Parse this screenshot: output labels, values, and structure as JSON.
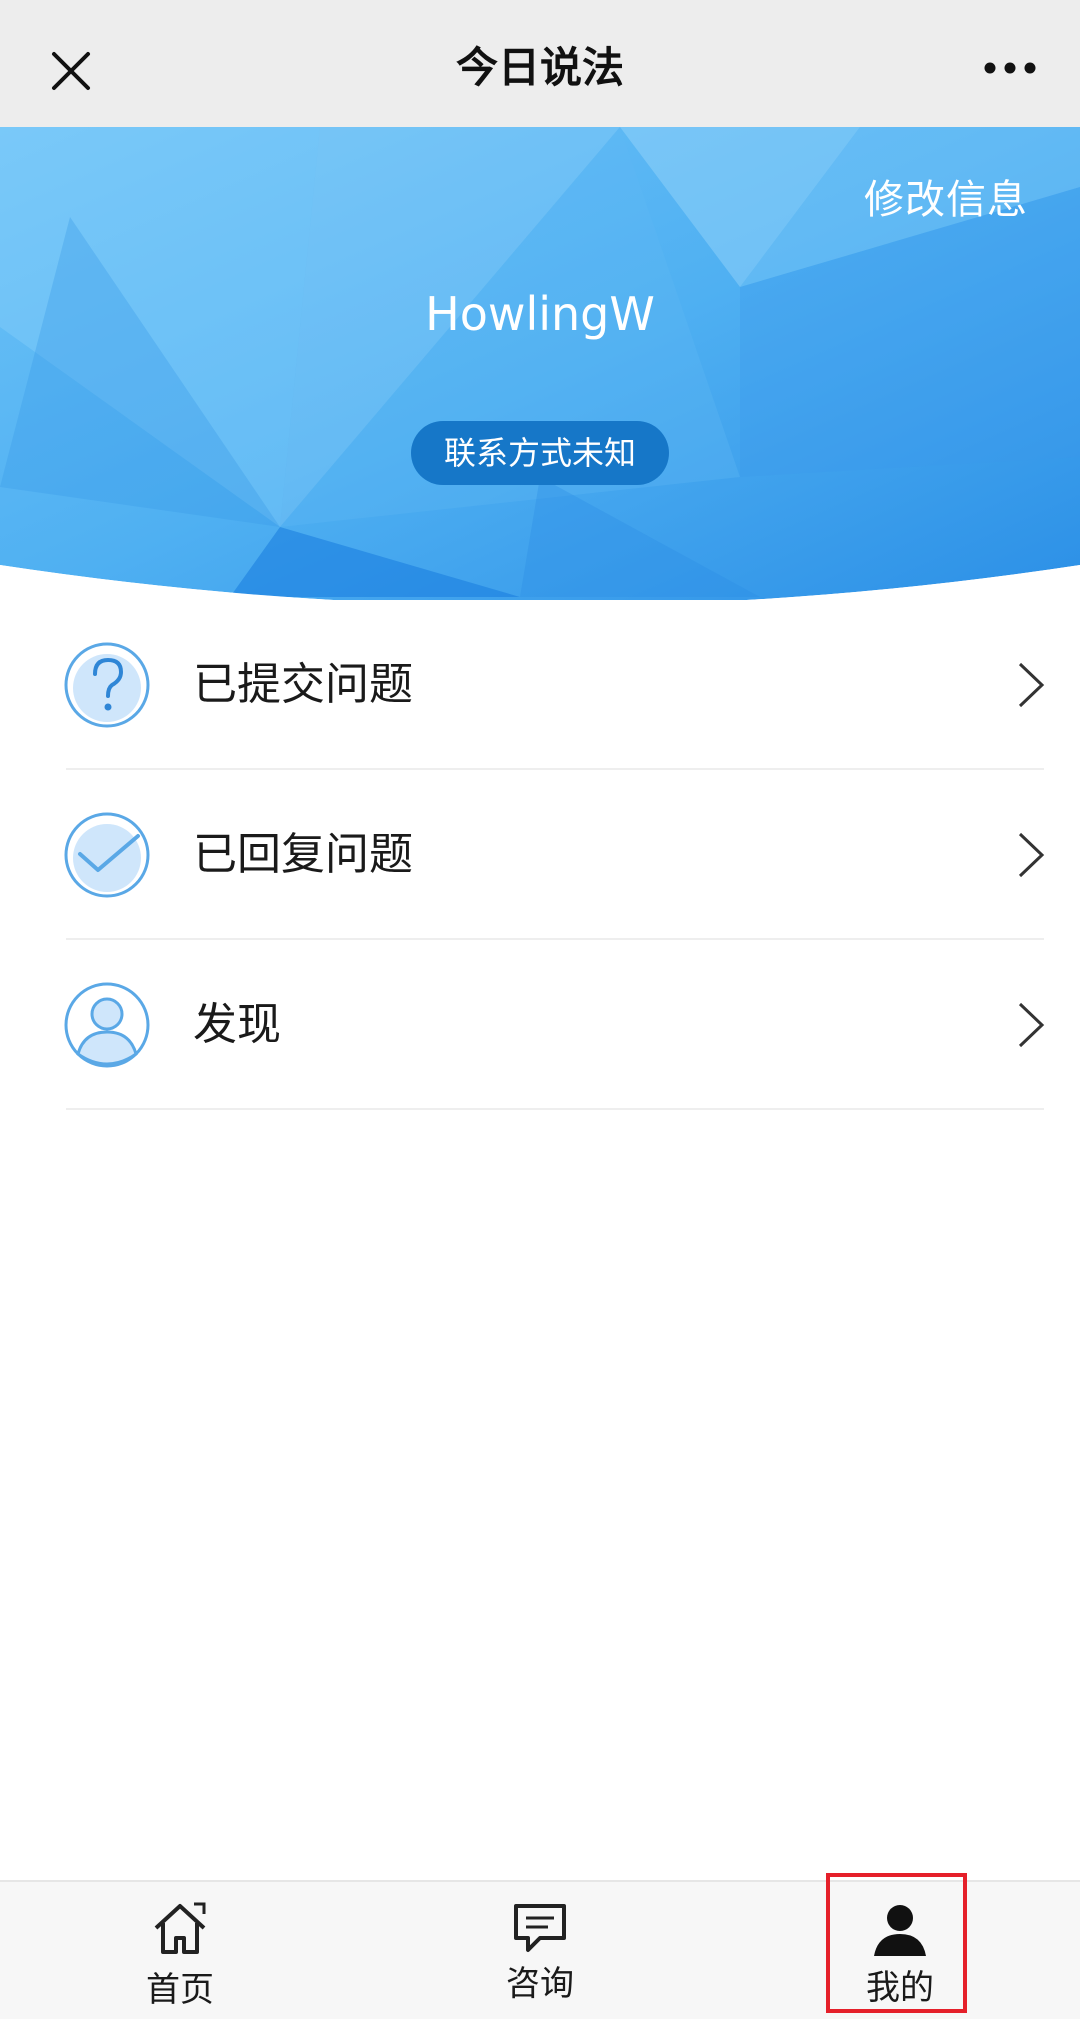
{
  "app": {
    "title": "今日说法",
    "close_icon": "close-icon",
    "more_icon": "more-icon"
  },
  "profile": {
    "edit_label": "修改信息",
    "username": "HowlingW",
    "contact_badge": "联系方式未知"
  },
  "menu": {
    "items": [
      {
        "label": "已提交问题",
        "icon": "question-icon"
      },
      {
        "label": "已回复问题",
        "icon": "check-icon"
      },
      {
        "label": "发现",
        "icon": "user-icon"
      }
    ]
  },
  "tabbar": {
    "tabs": [
      {
        "label": "首页",
        "icon": "home-icon"
      },
      {
        "label": "咨询",
        "icon": "chat-icon"
      },
      {
        "label": "我的",
        "icon": "person-icon",
        "active": true
      }
    ]
  },
  "colors": {
    "banner_blue": "#4aa9ee",
    "badge_blue": "#1677c8",
    "icon_blue": "#5aa8e6",
    "highlight_red": "#e5202a"
  }
}
